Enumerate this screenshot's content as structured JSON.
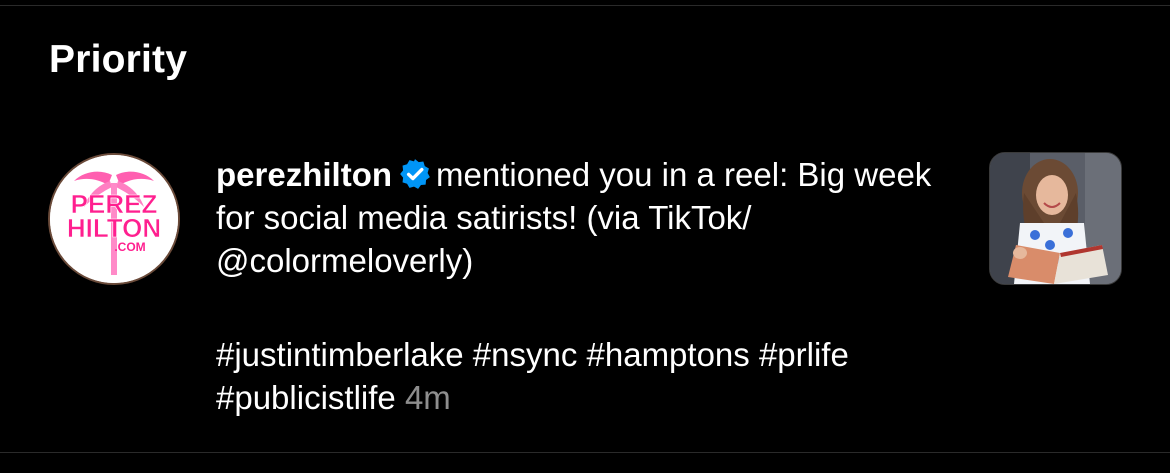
{
  "section": {
    "title": "Priority"
  },
  "notification": {
    "username": "perezhilton",
    "verified_icon": "verified-badge-icon",
    "message": "mentioned you in a reel: Big week for social media satirists! (via TikTok/ @colormeloverly)",
    "hashtags": "#justintimberlake #nsync #hamptons #prlife #publicistlife",
    "time": "4m",
    "avatar": {
      "logo_text_line1": "PEREZ",
      "logo_text_line2": "HILTON",
      "logo_text_line3": ".COM"
    }
  },
  "colors": {
    "background": "#000000",
    "text": "#ffffff",
    "muted": "#8e8e8e",
    "verified": "#0095f6",
    "brand_pink": "#ff2d95"
  }
}
